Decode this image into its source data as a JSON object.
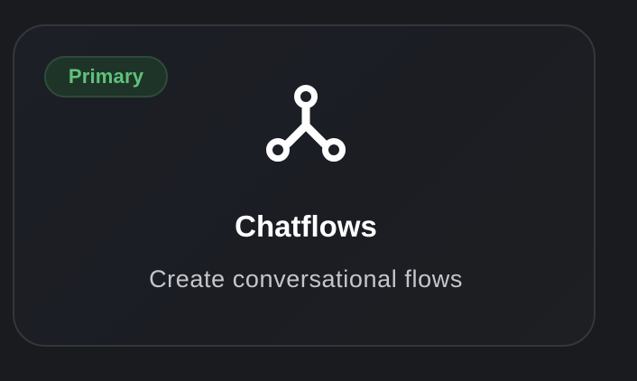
{
  "card": {
    "badge_label": "Primary",
    "icon": "flow-network-icon",
    "title": "Chatflows",
    "description": "Create conversational flows"
  },
  "colors": {
    "background": "#1a1b1f",
    "card_border": "#34363c",
    "badge_text": "#5fc27a",
    "badge_background": "#1f3428",
    "title": "#ffffff",
    "subtitle": "#c4c6cb"
  }
}
